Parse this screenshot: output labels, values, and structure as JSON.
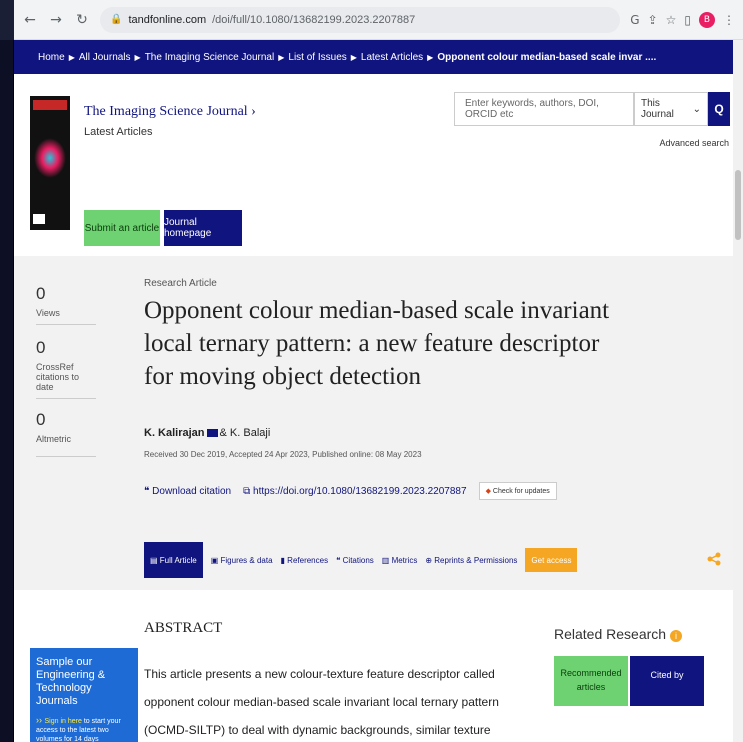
{
  "browser": {
    "url_domain": "tandfonline.com",
    "url_path": "/doi/full/10.1080/13682199.2023.2207887",
    "avatar_letter": "B"
  },
  "breadcrumb": [
    "Home",
    "All Journals",
    "The Imaging Science Journal",
    "List of Issues",
    "Latest Articles",
    "Opponent colour median-based scale invar ...."
  ],
  "journal": {
    "title": "The Imaging Science Journal",
    "subtitle": "Latest Articles",
    "search_placeholder": "Enter keywords, authors, DOI, ORCID etc",
    "scope": "This Journal",
    "advanced": "Advanced search",
    "submit": "Submit an article",
    "homepage": "Journal homepage"
  },
  "metrics": [
    {
      "value": "0",
      "label": "Views"
    },
    {
      "value": "0",
      "label": "CrossRef citations to date"
    },
    {
      "value": "0",
      "label": "Altmetric"
    }
  ],
  "article": {
    "type": "Research Article",
    "title": "Opponent colour median-based scale invariant local ternary pattern: a new feature descriptor for moving object detection",
    "author1": "K. Kalirajan",
    "author2": "& K. Balaji",
    "dates": "Received 30 Dec 2019, Accepted 24 Apr 2023, Published online: 08 May 2023",
    "download": "Download citation",
    "doi": "https://doi.org/10.1080/13682199.2023.2207887",
    "check": "Check for updates"
  },
  "tabs": {
    "full": "Full Article",
    "figures": "Figures & data",
    "references": "References",
    "citations": "Citations",
    "metrics": "Metrics",
    "reprints": "Reprints & Permissions",
    "get": "Get access"
  },
  "abstract": {
    "heading": "ABSTRACT",
    "text": "This article presents a new colour-texture feature descriptor called opponent colour median-based scale invariant local ternary pattern (OCMD-SILTP) to deal with dynamic backgrounds, similar texture regions, moving cast shadow, and illumination changes."
  },
  "related": {
    "heading": "Related Research",
    "recommended": "Recommended articles",
    "cited": "Cited by"
  },
  "promo": {
    "title": "Sample our Engineering & Technology Journals",
    "cta_link": "Sign in here",
    "cta_rest": "to start your access to the latest two volumes for 14 days"
  }
}
